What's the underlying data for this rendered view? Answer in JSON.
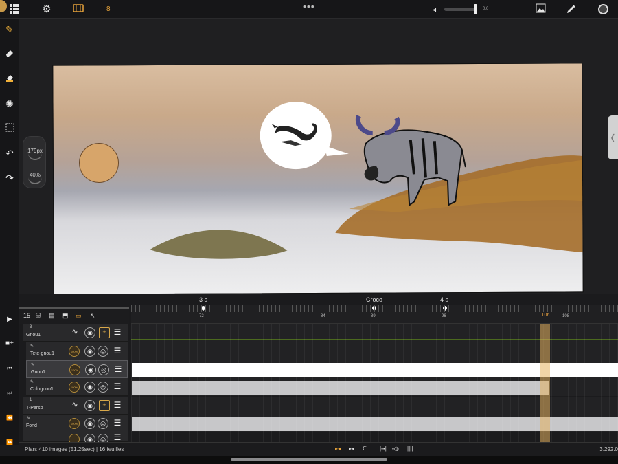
{
  "topbar": {
    "frame_number": "8",
    "volume_value": "0.0"
  },
  "icons": {
    "grid": "grid-icon",
    "settings": "gear-icon",
    "filmstrip": "filmstrip-icon",
    "more": "more-dots-icon",
    "volume": "speaker-icon",
    "image": "image-icon",
    "picker": "eyedropper-icon",
    "color": "color-swatch-icon"
  },
  "brush": {
    "size": "179px",
    "opacity": "40%"
  },
  "timeline": {
    "layer_count": "15",
    "markers": [
      {
        "label": "3 s"
      },
      {
        "label": "Croco"
      },
      {
        "label": "4 s"
      }
    ],
    "ticks": [
      "72",
      "84",
      "89",
      "96",
      "108"
    ],
    "current_frame": "106",
    "layers": [
      {
        "num": "3",
        "name": "Gnou1",
        "type": "group"
      },
      {
        "name": "Tete-gnou1",
        "type": "drawing"
      },
      {
        "name": "Gnou1",
        "type": "drawing"
      },
      {
        "name": "Colognou1",
        "type": "drawing"
      },
      {
        "num": "1",
        "name": "T-Perso",
        "type": "group"
      },
      {
        "name": "Fond",
        "type": "drawing"
      }
    ],
    "opacity_badge": "100%"
  },
  "status": {
    "info": "Plan: 410 images (51.25sec) | 16 feuilles",
    "zoom": "3.292.0"
  },
  "colors": {
    "accent": "#e8a43a",
    "track_line": "#4c6a1f",
    "background": "#1b1b1d"
  }
}
